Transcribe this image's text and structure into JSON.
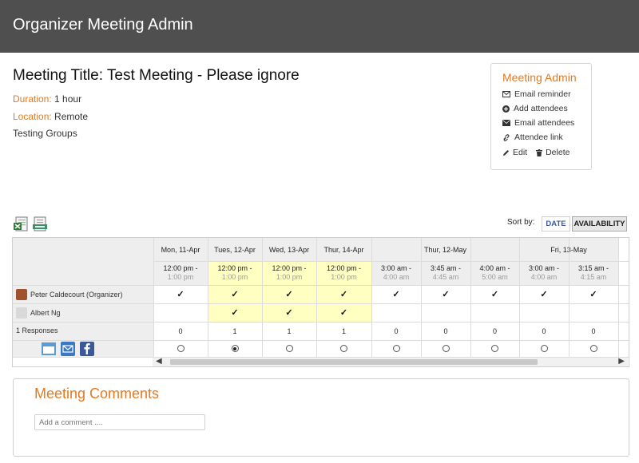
{
  "header": {
    "title": "Organizer Meeting Admin"
  },
  "meeting": {
    "title": "Meeting Title: Test Meeting - Please ignore",
    "duration_label": "Duration:",
    "duration_value": "1 hour",
    "location_label": "Location:",
    "location_value": "Remote",
    "group": "Testing Groups"
  },
  "admin": {
    "title": "Meeting Admin",
    "email_reminder": "Email reminder",
    "add_attendees": "Add attendees",
    "email_attendees": "Email attendees",
    "attendee_link": "Attendee link",
    "edit": "Edit",
    "delete": "Delete"
  },
  "sort": {
    "label": "Sort by:",
    "date": "DATE",
    "availability": "AVAILABILITY"
  },
  "dates": [
    {
      "label": "Mon, 11-Apr"
    },
    {
      "label": "Tues, 12-Apr"
    },
    {
      "label": "Wed, 13-Apr"
    },
    {
      "label": "Thur, 14-Apr"
    },
    {
      "label": "Thur, 12-May"
    },
    {
      "label": "Fri, 13-May"
    }
  ],
  "slots": [
    {
      "start": "12:00 pm -",
      "end": "1:00 pm",
      "highlight": false
    },
    {
      "start": "12:00 pm -",
      "end": "1:00 pm",
      "highlight": true
    },
    {
      "start": "12:00 pm -",
      "end": "1:00 pm",
      "highlight": true
    },
    {
      "start": "12:00 pm -",
      "end": "1:00 pm",
      "highlight": true
    },
    {
      "start": "3:00 am -",
      "end": "4:00 am",
      "highlight": false
    },
    {
      "start": "3:45 am -",
      "end": "4:45 am",
      "highlight": false
    },
    {
      "start": "4:00 am -",
      "end": "5:00 am",
      "highlight": false
    },
    {
      "start": "3:00 am -",
      "end": "4:00 am",
      "highlight": false
    },
    {
      "start": "3:15 am -",
      "end": "4:15 am",
      "highlight": false
    }
  ],
  "attendees": [
    {
      "name": "Peter Caldecourt (Organizer)",
      "checks": [
        true,
        true,
        true,
        true,
        true,
        true,
        true,
        true,
        true
      ]
    },
    {
      "name": "Albert Ng",
      "checks": [
        false,
        true,
        true,
        true,
        false,
        false,
        false,
        false,
        false
      ]
    }
  ],
  "responses": {
    "label": "1 Responses",
    "counts": [
      "0",
      "1",
      "1",
      "1",
      "0",
      "0",
      "0",
      "0",
      "0"
    ]
  },
  "selected_slot": 1,
  "check_mark": "✓",
  "comments": {
    "title": "Meeting Comments",
    "placeholder": "Add a comment ...."
  },
  "colors": {
    "accent": "#e8791c",
    "highlight": "#ffffc2",
    "topbar": "#4f4f4f"
  }
}
